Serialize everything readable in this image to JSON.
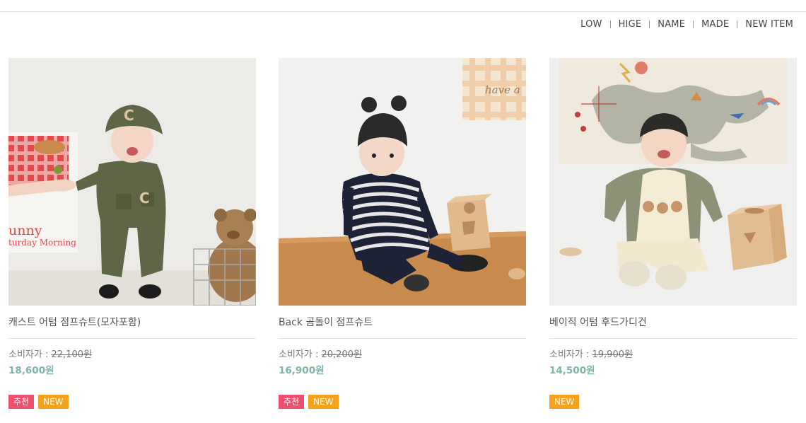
{
  "sort_menu": {
    "items": [
      "LOW",
      "HIGE",
      "NAME",
      "MADE",
      "NEW ITEM"
    ]
  },
  "products": [
    {
      "name": "캐스트 어텀 점프슈트(모자포함)",
      "consumer_label": "소비자가 : ",
      "consumer_price": "22,100원",
      "price": "18,600원",
      "badges": {
        "recommend": "추천",
        "new": "NEW"
      },
      "image_icon": "baby-in-green-jumpsuit-photo"
    },
    {
      "name": "Back 곰돌이 점프슈트",
      "consumer_label": "소비자가 : ",
      "consumer_price": "20,200원",
      "price": "16,900원",
      "badges": {
        "recommend": "추천",
        "new": "NEW"
      },
      "image_icon": "baby-in-striped-jumpsuit-photo",
      "photo_text": "have a"
    },
    {
      "name": "베이직 어텀 후드가디건",
      "consumer_label": "소비자가 : ",
      "consumer_price": "19,900원",
      "price": "14,500원",
      "badges": {
        "new": "NEW"
      },
      "image_icon": "baby-in-cardigan-photo"
    }
  ],
  "photo1_text": {
    "line1": "unny",
    "line2": "turday Morning"
  },
  "colors": {
    "price": "#7fb4a8",
    "badge_recommend": "#f0506e",
    "badge_new": "#f7a21b"
  }
}
